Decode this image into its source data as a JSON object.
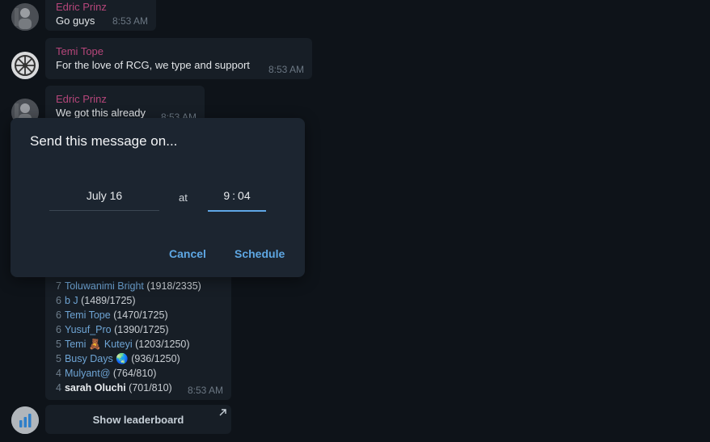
{
  "messages": [
    {
      "sender": "Edric Prinz",
      "text": "Go guys",
      "time": "8:53 AM"
    },
    {
      "sender": "Temi Tope",
      "text": "For  the love of RCG, we type and support",
      "time": "8:53 AM"
    },
    {
      "sender": "Edric Prinz",
      "text": "We got this already",
      "time": "8:53 AM"
    }
  ],
  "leaderboard": {
    "rows": [
      {
        "rank": "7",
        "name": "Toluwanimi Bright",
        "score": "(1918/2335)"
      },
      {
        "rank": "6",
        "name": "b J",
        "score": "(1489/1725)"
      },
      {
        "rank": "6",
        "name": "Temi Tope",
        "score": "(1470/1725)"
      },
      {
        "rank": "6",
        "name": "Yusuf_Pro",
        "score": "(1390/1725)"
      },
      {
        "rank": "5",
        "name": "Temi 🧸 Kuteyi",
        "score": "(1203/1250)"
      },
      {
        "rank": "5",
        "name": "Busy Days 🌏",
        "score": "(936/1250)"
      },
      {
        "rank": "4",
        "name": "Mulyant@",
        "score": "(764/810)"
      },
      {
        "rank": "4",
        "name": "sarah Oluchi",
        "score": "(701/810)"
      }
    ],
    "time": "8:53 AM",
    "button_label": "Show leaderboard"
  },
  "schedule_dialog": {
    "title": "Send this message on...",
    "date": "July 16",
    "at_label": "at",
    "hour": "9",
    "colon": ":",
    "minute": "04",
    "cancel_label": "Cancel",
    "schedule_label": "Schedule",
    "accent_color": "#5ea7e3"
  },
  "colors": {
    "background": "#0e1319",
    "bubble": "#171e26",
    "dialog": "#1c2530",
    "sender_name": "#b5467a",
    "link": "#6ea4d4"
  }
}
